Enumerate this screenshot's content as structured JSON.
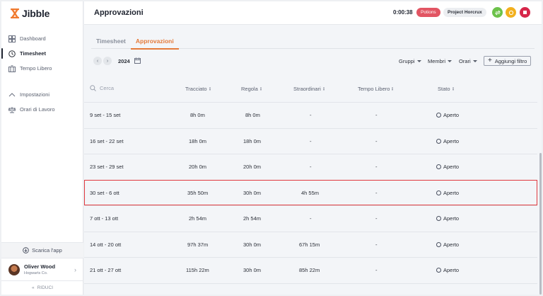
{
  "app": {
    "brand": "Jibble"
  },
  "sidebar": {
    "items": [
      {
        "label": "Dashboard",
        "icon": "dashboard-icon"
      },
      {
        "label": "Timesheet",
        "icon": "clock-icon",
        "active": true
      },
      {
        "label": "Tempo Libero",
        "icon": "palm-icon"
      }
    ],
    "settings": [
      {
        "label": "Impostazioni",
        "icon": "chevron-up-icon"
      },
      {
        "label": "Orari di Lavoro",
        "icon": "scale-icon"
      }
    ],
    "download_label": "Scarica l'app",
    "user": {
      "name": "Oliver Wood",
      "org": "Hogwarts Co."
    },
    "collapse_label": "RIDUCI"
  },
  "header": {
    "title": "Approvazioni",
    "timer": "0:00:38",
    "activity": "Potions",
    "project": "Project Horcrux",
    "colors": {
      "green": "#6cc24a",
      "yellow": "#f2b01e",
      "red": "#d6264a"
    }
  },
  "tabs": [
    {
      "label": "Timesheet",
      "active": false
    },
    {
      "label": "Approvazioni",
      "active": true
    }
  ],
  "toolbar": {
    "year": "2024",
    "filters": [
      "Gruppi",
      "Membri",
      "Orari"
    ],
    "add_filter": "Aggiungi filtro"
  },
  "table": {
    "search_placeholder": "Cerca",
    "columns": [
      "Tracciato",
      "Regola",
      "Straordinari",
      "Tempo Libero",
      "Stato"
    ],
    "rows": [
      {
        "period": "9 set - 15 set",
        "tracked": "8h 0m",
        "regular": "8h 0m",
        "overtime": "-",
        "timeoff": "-",
        "status": "Aperto"
      },
      {
        "period": "16 set - 22 set",
        "tracked": "18h 0m",
        "regular": "18h 0m",
        "overtime": "-",
        "timeoff": "-",
        "status": "Aperto"
      },
      {
        "period": "23 set - 29 set",
        "tracked": "20h 0m",
        "regular": "20h 0m",
        "overtime": "-",
        "timeoff": "-",
        "status": "Aperto"
      },
      {
        "period": "30 set - 6 ott",
        "tracked": "35h 50m",
        "regular": "30h 0m",
        "overtime": "4h 55m",
        "timeoff": "-",
        "status": "Aperto",
        "highlight": true
      },
      {
        "period": "7 ott - 13 ott",
        "tracked": "2h 54m",
        "regular": "2h 54m",
        "overtime": "-",
        "timeoff": "-",
        "status": "Aperto"
      },
      {
        "period": "14 ott - 20 ott",
        "tracked": "97h 37m",
        "regular": "30h 0m",
        "overtime": "67h 15m",
        "timeoff": "-",
        "status": "Aperto"
      },
      {
        "period": "21 ott - 27 ott",
        "tracked": "115h 22m",
        "regular": "30h 0m",
        "overtime": "85h 22m",
        "timeoff": "-",
        "status": "Aperto"
      }
    ]
  }
}
